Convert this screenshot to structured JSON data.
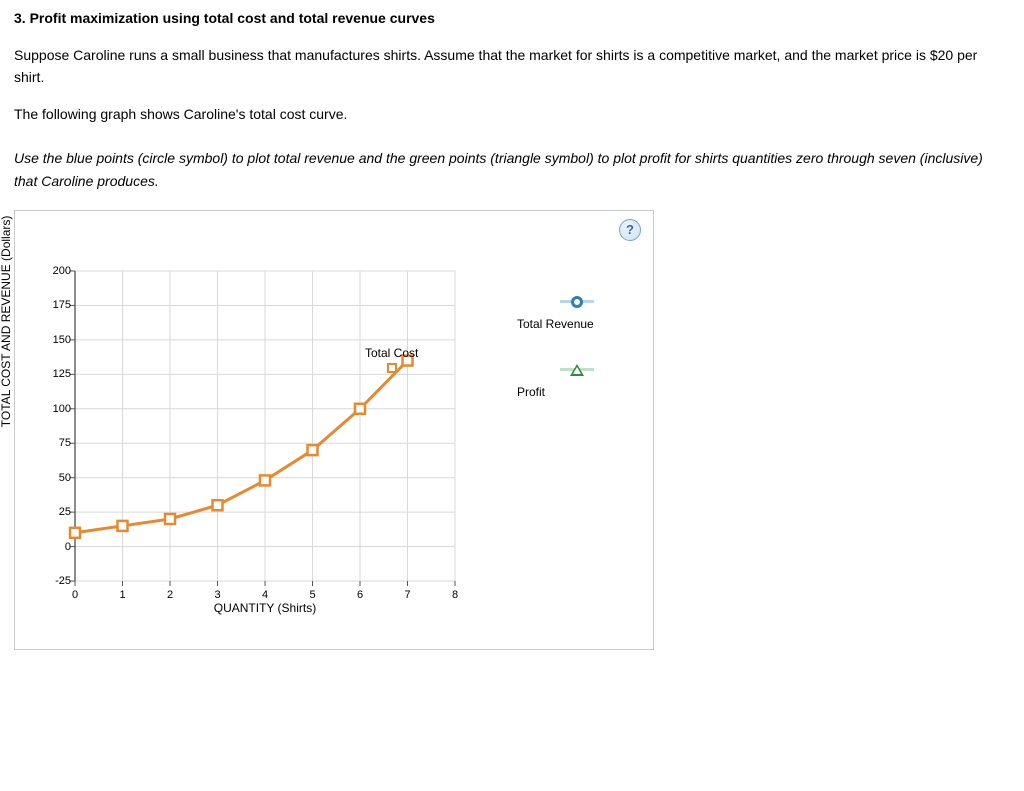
{
  "title": "3. Profit maximization using total cost and total revenue curves",
  "p1": "Suppose Caroline runs a small business that manufactures shirts. Assume that the market for shirts is a competitive market, and the market price is $20 per shirt.",
  "p2": "The following graph shows Caroline's total cost curve.",
  "instruction": "Use the blue points (circle symbol) to plot total revenue and the green points (triangle symbol) to plot profit for shirts quantities zero through seven (inclusive) that Caroline produces.",
  "help": "?",
  "legend": {
    "total_revenue": "Total Revenue",
    "profit": "Profit"
  },
  "chart_label": {
    "total_cost": "Total Cost"
  },
  "chart_data": {
    "type": "line",
    "title": "",
    "xlabel": "QUANTITY (Shirts)",
    "ylabel": "TOTAL COST AND REVENUE (Dollars)",
    "xlim": [
      0,
      8
    ],
    "ylim": [
      -25,
      200
    ],
    "xticks": [
      0,
      1,
      2,
      3,
      4,
      5,
      6,
      7,
      8
    ],
    "yticks": [
      -25,
      0,
      25,
      50,
      75,
      100,
      125,
      150,
      175,
      200
    ],
    "series": [
      {
        "name": "Total Cost",
        "color": "#e9892f",
        "marker": "square",
        "x": [
          0,
          1,
          2,
          3,
          4,
          5,
          6,
          7
        ],
        "y": [
          10,
          15,
          20,
          30,
          48,
          70,
          100,
          135
        ]
      }
    ],
    "legend_series": [
      {
        "name": "Total Revenue",
        "marker": "circle",
        "color": "#2a7fbf"
      },
      {
        "name": "Profit",
        "marker": "triangle",
        "color": "#2e8b3d"
      }
    ]
  }
}
